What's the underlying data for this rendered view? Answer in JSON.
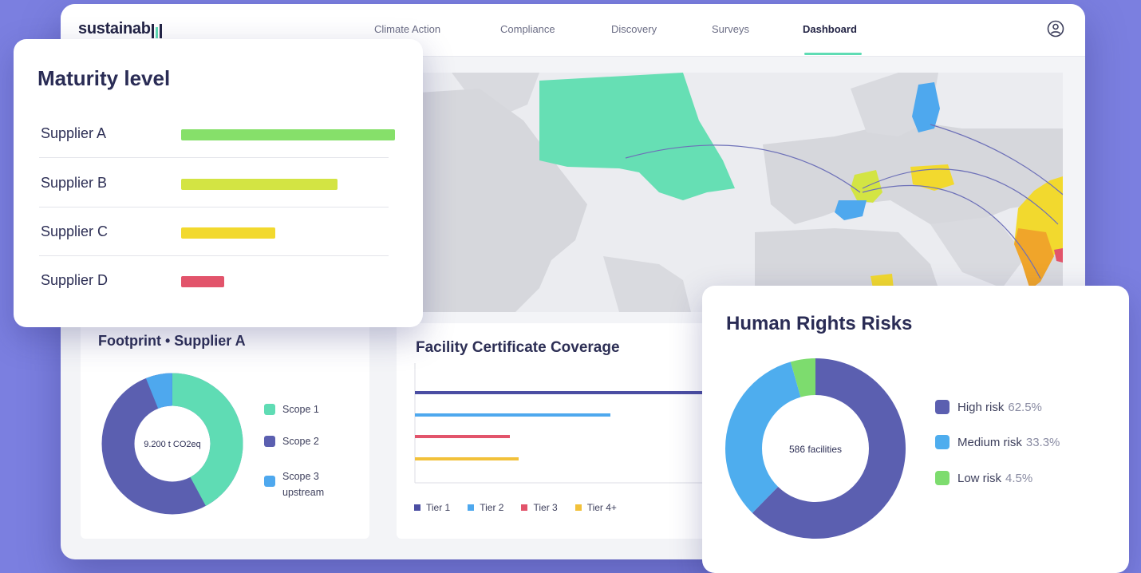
{
  "brand": {
    "name": "sustainab",
    "accent": "#5fdcb4"
  },
  "nav": {
    "items": [
      {
        "label": "Climate Action"
      },
      {
        "label": "Compliance"
      },
      {
        "label": "Discovery"
      },
      {
        "label": "Surveys"
      },
      {
        "label": "Dashboard"
      }
    ],
    "active": "Dashboard",
    "user_icon": "user-circle-icon"
  },
  "maturity": {
    "title": "Maturity level",
    "suppliers": [
      {
        "label": "Supplier A",
        "level": 1.0,
        "color": "#86e06a"
      },
      {
        "label": "Supplier B",
        "level": 0.73,
        "color": "#d3e443"
      },
      {
        "label": "Supplier C",
        "level": 0.44,
        "color": "#f2d92e"
      },
      {
        "label": "Supplier D",
        "level": 0.2,
        "color": "#e2546b"
      }
    ]
  },
  "footprint": {
    "title": "Footprint • Supplier A",
    "center_label": "9.200 t CO2eq",
    "legend": [
      {
        "label": "Scope 1",
        "color": "#5fdcb4"
      },
      {
        "label": "Scope 2",
        "color": "#5b5fb0"
      },
      {
        "label": "Scope 3 upstream",
        "color": "#4ea8ee"
      }
    ]
  },
  "facility": {
    "title": "Facility Certificate Coverage",
    "legend": [
      {
        "label": "Tier 1",
        "color": "#4b4ea3"
      },
      {
        "label": "Tier 2",
        "color": "#4ea8ee"
      },
      {
        "label": "Tier 3",
        "color": "#e2546b"
      },
      {
        "label": "Tier 4+",
        "color": "#f2c13a"
      }
    ]
  },
  "human_rights": {
    "title": "Human Rights Risks",
    "center_label": "586 facilities",
    "legend": [
      {
        "label": "High risk",
        "pct": "62.5%",
        "color": "#5b5fb0"
      },
      {
        "label": "Medium risk",
        "pct": "33.3%",
        "color": "#4eadee"
      },
      {
        "label": "Low risk",
        "pct": "4.5%",
        "color": "#7ddc6e"
      }
    ]
  },
  "chart_data": [
    {
      "type": "bar",
      "title": "Maturity level",
      "categories": [
        "Supplier A",
        "Supplier B",
        "Supplier C",
        "Supplier D"
      ],
      "values": [
        1.0,
        0.73,
        0.44,
        0.2
      ]
    },
    {
      "type": "pie",
      "title": "Footprint • Supplier A",
      "categories": [
        "Scope 1",
        "Scope 2",
        "Scope 3 upstream"
      ],
      "values": [
        0.42,
        0.52,
        0.06
      ]
    },
    {
      "type": "bar",
      "title": "Facility Certificate Coverage",
      "categories": [
        "Tier 1",
        "Tier 2",
        "Tier 3",
        "Tier 4+"
      ],
      "values": [
        1.0,
        0.68,
        0.33,
        0.36
      ]
    },
    {
      "type": "pie",
      "title": "Human Rights Risks",
      "categories": [
        "High risk",
        "Medium risk",
        "Low risk"
      ],
      "values": [
        62.5,
        33.3,
        4.5
      ]
    }
  ]
}
